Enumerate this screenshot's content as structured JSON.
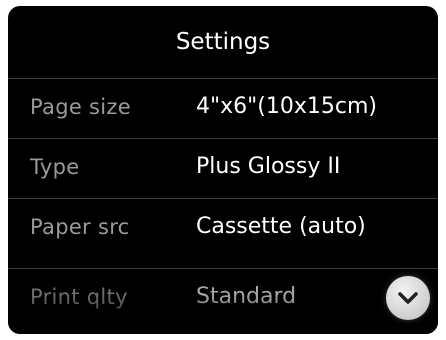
{
  "header": {
    "title": "Settings"
  },
  "settings": [
    {
      "label": "Page size",
      "value": "4\"x6\"(10x15cm)"
    },
    {
      "label": "Type",
      "value": "Plus Glossy II"
    },
    {
      "label": "Paper src",
      "value": "Cassette (auto)"
    },
    {
      "label": "Print qlty",
      "value": "Standard"
    }
  ],
  "scroll_down_icon": "chevron-down-icon",
  "colors": {
    "background": "#000000",
    "label": "#9a9a9a",
    "value": "#ffffff"
  }
}
